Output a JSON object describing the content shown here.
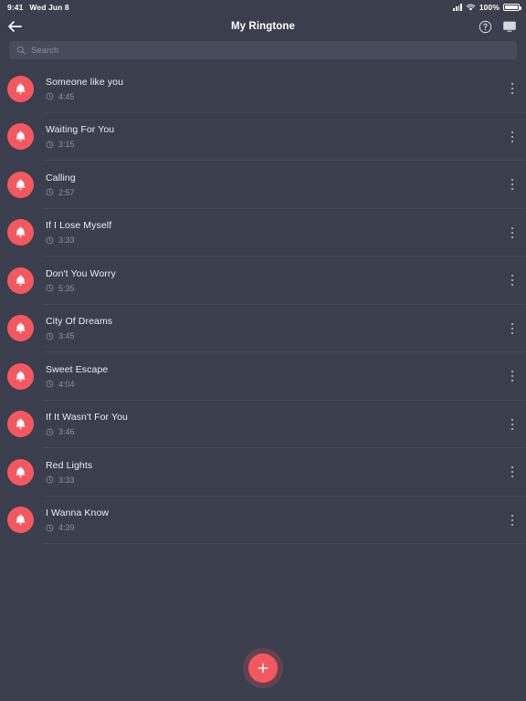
{
  "status_bar": {
    "time": "9:41",
    "date": "Wed Jun 8",
    "battery_percent": "100%",
    "signal_icon": "cellular-bars-icon",
    "wifi_icon": "wifi-icon",
    "battery_icon": "battery-full-icon"
  },
  "header": {
    "title": "My Ringtone",
    "back_icon": "back-arrow-icon",
    "help_icon": "help-circle-icon",
    "cast_icon": "monitor-icon"
  },
  "search": {
    "placeholder": "Search",
    "value": "",
    "icon": "search-icon"
  },
  "list": {
    "item_icon": "bell-icon",
    "duration_icon": "clock-icon",
    "overflow_icon": "more-vertical-icon",
    "items": [
      {
        "title": "Someone like you",
        "duration": "4:45"
      },
      {
        "title": "Waiting For You",
        "duration": "3:15"
      },
      {
        "title": "Calling",
        "duration": "2:57"
      },
      {
        "title": "If I Lose Myself",
        "duration": "3:33"
      },
      {
        "title": "Don't You Worry",
        "duration": "5:35"
      },
      {
        "title": "City Of Dreams",
        "duration": "3:45"
      },
      {
        "title": "Sweet Escape",
        "duration": "4:04"
      },
      {
        "title": "If It Wasn't For You",
        "duration": "3:46"
      },
      {
        "title": "Red Lights",
        "duration": "3:33"
      },
      {
        "title": "I Wanna Know",
        "duration": "4:39"
      }
    ]
  },
  "fab": {
    "label": "+",
    "icon": "plus-icon"
  },
  "colors": {
    "background": "#3b3e4d",
    "accent": "#f4585e",
    "search_field": "#474b5c",
    "divider": "#45495a",
    "title_text": "#eceef3",
    "muted_text": "#8e91a1"
  }
}
